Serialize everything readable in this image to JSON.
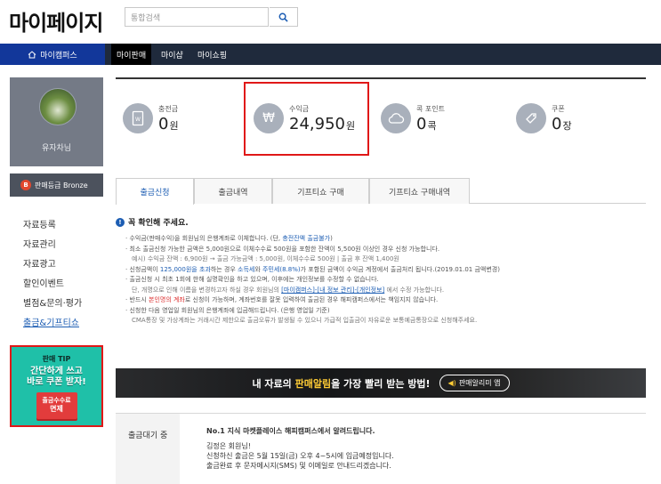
{
  "header": {
    "title": "마이페이지",
    "search_placeholder": "통합검색",
    "search_icon": "search-icon"
  },
  "navbar": {
    "home_label": "마이캠퍼스",
    "tabs": [
      "마이판매",
      "마이샵",
      "마이쇼핑"
    ]
  },
  "sidebar": {
    "user_name": "유자차님",
    "grade_badge": "B",
    "grade_label": "판매등급 Bronze",
    "menu": [
      "자료등록",
      "자료관리",
      "자료광고",
      "할인이벤트",
      "별점&문의·평가",
      "출금&기프티쇼"
    ],
    "tip": {
      "title": "판매 TIP",
      "line1": "간단하게 쓰고",
      "line2": "바로 쿠폰 받자!",
      "ticket_line1": "출금수수료",
      "ticket_line2": "면제"
    }
  },
  "summary": [
    {
      "label": "충전금",
      "value": "0",
      "unit": "원",
      "icon": "wallet-icon"
    },
    {
      "label": "수익금",
      "value": "24,950",
      "unit": "원",
      "icon": "won-icon"
    },
    {
      "label": "콕 포인트",
      "value": "0",
      "unit": "콕",
      "icon": "cloud-icon"
    },
    {
      "label": "쿠폰",
      "value": "0",
      "unit": "장",
      "icon": "coupon-icon"
    }
  ],
  "tabs": [
    "출금신청",
    "출금내역",
    "기프티쇼 구매",
    "기프티쇼 구매내역"
  ],
  "notice": {
    "title": "꼭 확인해 주세요.",
    "l1a": "· 수익금(판매수익)을 회원님의 은행계좌로 이체합니다. (단, ",
    "l1b": "충전잔액 출금불가",
    "l1c": ")",
    "l2": "· 최소 출금신청 가능한 금액은 5,000원으로 이체수수료 500원을 포함한 잔액이 5,500원 이상인 경우 신청 가능합니다.",
    "l3": "예시) 수익금 잔액 : 6,900원 → 출금 가능금액 : 5,000원, 이체수수료 500원  |  출금 후 잔액 1,400원",
    "l4a": "· 신청금액이 ",
    "l4b": "125,000원을 초과",
    "l4c": "하는 경우 ",
    "l4d": "소득세",
    "l4e": "와 ",
    "l4f": "주민세(8.8%)",
    "l4g": "가 포함된 금액이 수익금 계정에서 출금처리 됩니다.(2019.01.01 금액변경)",
    "l5": "· 출금신청 시 최초 1회에 한해 실명확인을 하고 있으며, 이후에는 개인정보를 수정할 수 없습니다.",
    "l6a": "단, 개명으로 인해 이름을 변경하고자 하실 경우 회원님의 ",
    "l6b": "[마이캠퍼스]-[내 정보 관리]-[개인정보]",
    "l6c": " 에서 수정 가능합니다.",
    "l7a": "· 반드시 ",
    "l7b": "본인명의 계좌",
    "l7c": "로 신청이 가능하며, 계좌번호를 잘못 입력하여 출금된 경우 해피캠퍼스에서는 책임지지 않습니다.",
    "l8": "· 신청한 다음 영업일 회원님의 은행계좌에 입금해드립니다. (은행 영업일 기준)",
    "l9": "CMA통장 및 가상계좌는 거래시간 제한으로 출금오류가 발생될 수 있으니 가급적 입출금이 자유로운 보통예금통장으로 신청해주세요."
  },
  "banner": {
    "text_a": "내 자료의 ",
    "text_b": "판매알림",
    "text_c": "을 가장 빨리 받는 방법!",
    "button": "판매알리미 앱"
  },
  "wait": {
    "label": "출금대기 중",
    "title": "No.1 지식 마켓플레이스 해피캠퍼스에서 알려드립니다.",
    "greeting": "김정은 회원님!",
    "line1": "신청하신 출금은 5월 15일(금) 오후 4~5시에 입금예정입니다.",
    "line2": "출금완료 후 문자메시지(SMS) 및 이메일로 안내드리겠습니다."
  }
}
